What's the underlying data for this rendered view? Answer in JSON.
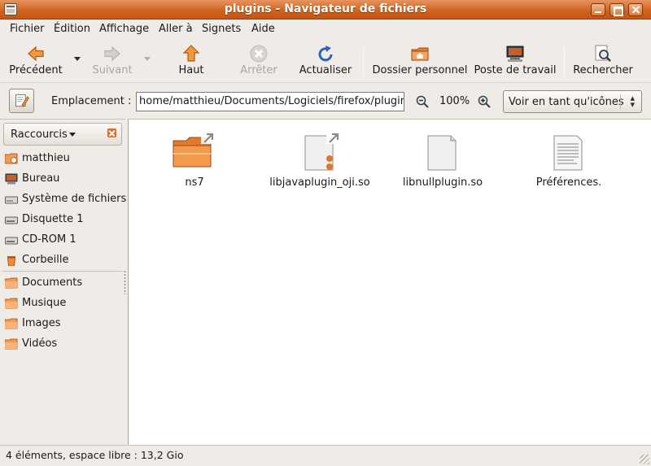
{
  "window": {
    "title": "plugins - Navigateur de fichiers"
  },
  "menubar": {
    "items": [
      "Fichier",
      "Édition",
      "Affichage",
      "Aller à",
      "Signets",
      "Aide"
    ]
  },
  "toolbar": {
    "back": "Précédent",
    "forward": "Suivant",
    "up": "Haut",
    "stop": "Arrêter",
    "reload": "Actualiser",
    "home": "Dossier personnel",
    "computer": "Poste de travail",
    "search": "Rechercher"
  },
  "location": {
    "label": "Emplacement :",
    "path": "home/matthieu/Documents/Logiciels/firefox/plugins",
    "zoom": "100%",
    "view_mode": "Voir en tant qu'icônes"
  },
  "sidebar": {
    "header": "Raccourcis",
    "items": [
      "matthieu",
      "Bureau",
      "Système de fichiers",
      "Disquette 1",
      "CD-ROM 1",
      "Corbeille"
    ],
    "bookmarks": [
      "Documents",
      "Musique",
      "Images",
      "Vidéos"
    ]
  },
  "files": [
    "ns7",
    "libjavaplugin_oji.so",
    "libnullplugin.so",
    "Préférences."
  ],
  "status": {
    "text": "4 éléments, espace libre : 13,2 Gio"
  },
  "colors": {
    "accent": "#d0641f",
    "folder": "#f08a3a",
    "background": "#efebe7"
  }
}
